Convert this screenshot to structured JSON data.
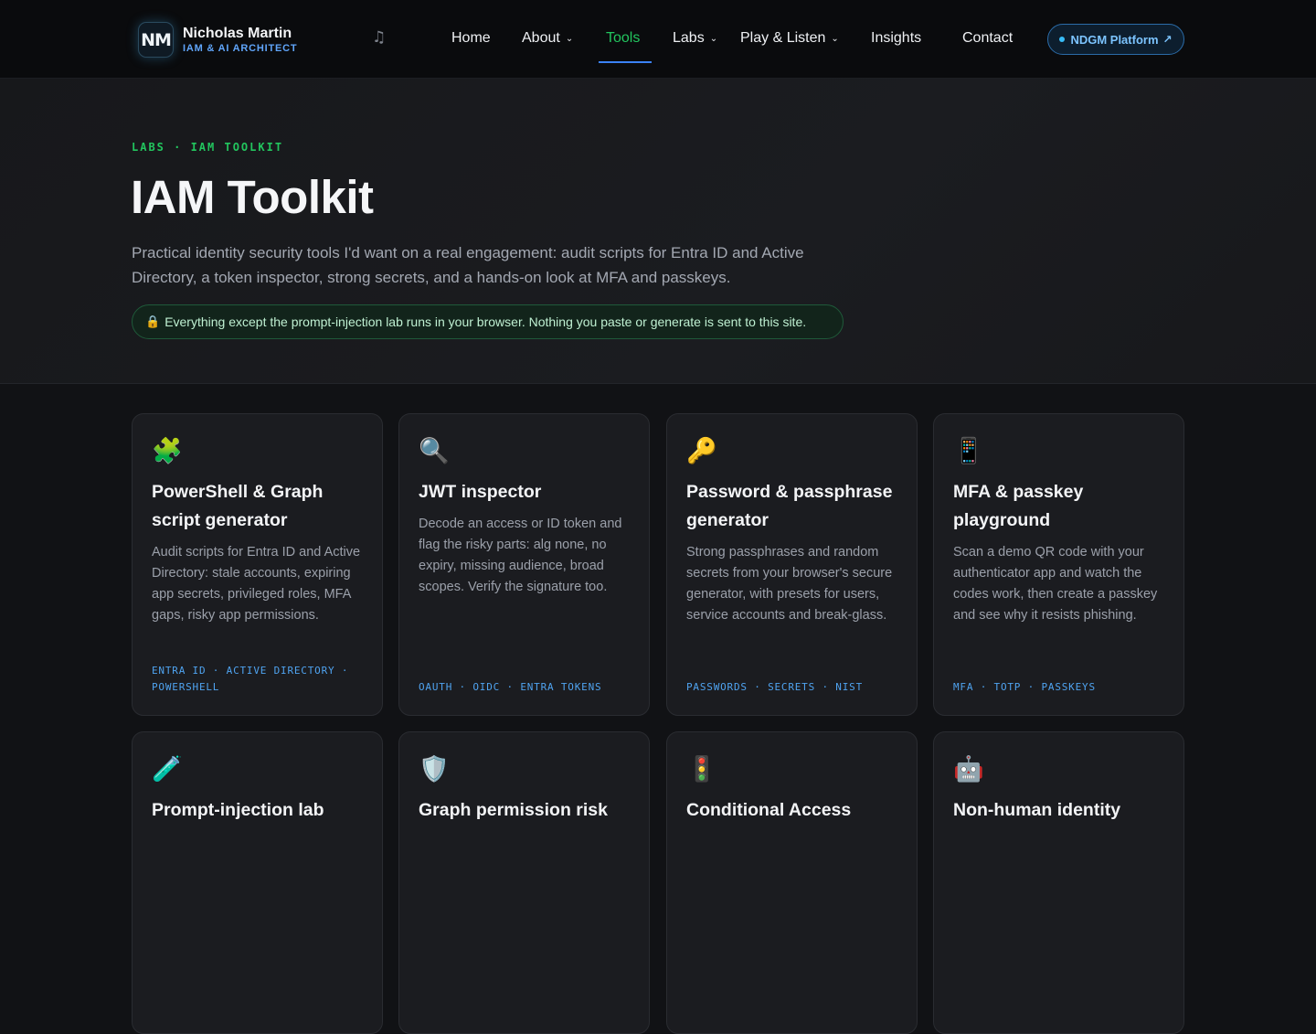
{
  "nav": {
    "brand_name": "Nicholas Martin",
    "brand_sub": "IAM & AI ARCHITECT",
    "logo_text": "NM",
    "music_icon": "♫",
    "items": [
      {
        "label": "Home",
        "dropdown": false
      },
      {
        "label": "About",
        "dropdown": true
      },
      {
        "label": "Tools",
        "dropdown": false,
        "active": true
      },
      {
        "label": "Labs",
        "dropdown": true
      },
      {
        "label": "Play & Listen",
        "dropdown": true
      },
      {
        "label": "Insights",
        "dropdown": false
      },
      {
        "label": "Contact",
        "dropdown": false
      }
    ],
    "chevron": "⌄",
    "platform_label": "NDGM Platform",
    "platform_arrow": "↗"
  },
  "hero": {
    "eyebrow": "LABS · IAM TOOLKIT",
    "title": "IAM Toolkit",
    "description": "Practical identity security tools I'd want on a real engagement: audit scripts for Entra ID and Active Directory, a token inspector, strong secrets, and a hands-on look at MFA and passkeys.",
    "notice_icon": "🔒",
    "notice": "Everything except the prompt-injection lab runs in your browser. Nothing you paste or generate is sent to this site."
  },
  "cards": [
    {
      "icon": "🧩",
      "title": "PowerShell & Graph script generator",
      "description": "Audit scripts for Entra ID and Active Directory: stale accounts, expiring app secrets, privileged roles, MFA gaps, risky app permissions.",
      "tags": "ENTRA ID · ACTIVE DIRECTORY · POWERSHELL"
    },
    {
      "icon": "🔍",
      "title": "JWT inspector",
      "description": "Decode an access or ID token and flag the risky parts: alg none, no expiry, missing audience, broad scopes. Verify the signature too.",
      "tags": "OAUTH · OIDC · ENTRA TOKENS"
    },
    {
      "icon": "🔑",
      "title": "Password & passphrase generator",
      "description": "Strong passphrases and random secrets from your browser's secure generator, with presets for users, service accounts and break-glass.",
      "tags": "PASSWORDS · SECRETS · NIST"
    },
    {
      "icon": "📱",
      "title": "MFA & passkey playground",
      "description": "Scan a demo QR code with your authenticator app and watch the codes work, then create a passkey and see why it resists phishing.",
      "tags": "MFA · TOTP · PASSKEYS"
    },
    {
      "icon": "🧪",
      "title": "Prompt-injection lab",
      "description": "",
      "tags": ""
    },
    {
      "icon": "🛡️",
      "title": "Graph permission risk",
      "description": "",
      "tags": ""
    },
    {
      "icon": "🚦",
      "title": "Conditional Access",
      "description": "",
      "tags": ""
    },
    {
      "icon": "🤖",
      "title": "Non-human identity",
      "description": "",
      "tags": ""
    }
  ]
}
